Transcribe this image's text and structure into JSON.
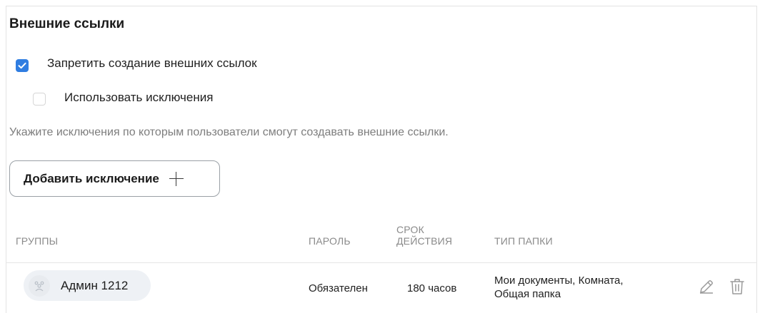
{
  "section": {
    "title": "Внешние ссылки"
  },
  "options": {
    "forbid": {
      "label": "Запретить создание внешних ссылок",
      "checked": true
    },
    "exceptions": {
      "label": "Использовать исключения",
      "checked": false
    }
  },
  "hint": "Укажите исключения по которым пользователи смогут создавать внешние ссылки.",
  "add_button": {
    "label": "Добавить исключение",
    "icon": "plus-icon"
  },
  "table": {
    "headers": {
      "groups": "ГРУППЫ",
      "password": "ПАРОЛЬ",
      "duration_line1": "СРОК",
      "duration_line2": "ДЕЙСТВИЯ",
      "folder_type": "ТИП ПАПКИ"
    },
    "rows": [
      {
        "group": "Админ 1212",
        "avatar_icon": "group-avatar-icon",
        "password": "Обязателен",
        "duration": "180 часов",
        "folder_type_line1": "Мои документы, Комната,",
        "folder_type_line2": "Общая папка",
        "actions": [
          "edit-icon",
          "trash-icon"
        ]
      }
    ]
  },
  "colors": {
    "accent": "#2f7de1",
    "muted_text": "#7d7d7d",
    "chip_bg": "#eef1f5"
  }
}
